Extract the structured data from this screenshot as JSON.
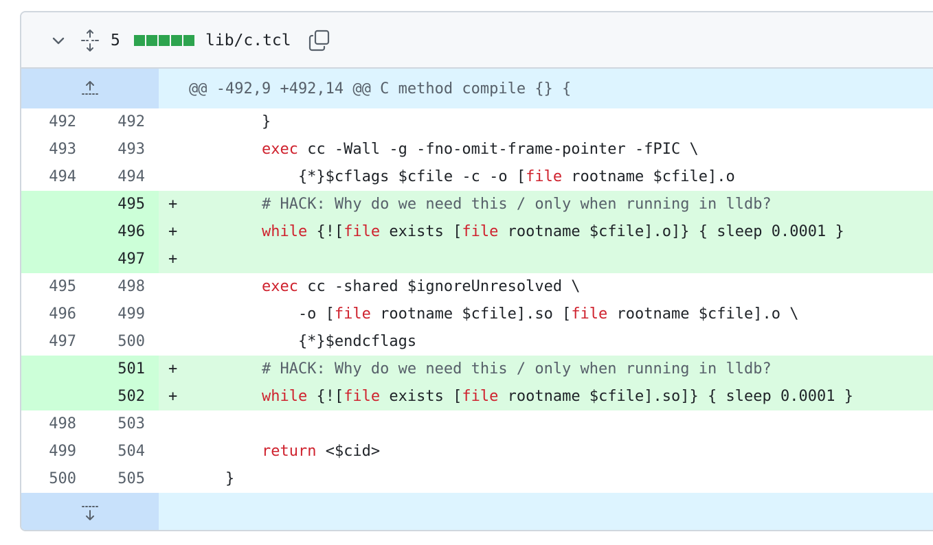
{
  "file_header": {
    "changes_count": "5",
    "diffstat_colors": [
      "#2da44e",
      "#2da44e",
      "#2da44e",
      "#2da44e",
      "#2da44e"
    ],
    "file_name": "lib/c.tcl",
    "icons": {
      "collapse": "chevron-down-icon",
      "expand": "unfold-icon",
      "copy": "copy-icon"
    }
  },
  "hunk": {
    "header": "@@ -492,9 +492,14 @@ C method compile {} {",
    "expand_up_icon": "expand-up-icon",
    "expand_down_icon": "expand-down-icon"
  },
  "lines": [
    {
      "type": "ctx",
      "old": "492",
      "new": "492",
      "segs": [
        {
          "t": "        }"
        }
      ]
    },
    {
      "type": "ctx",
      "old": "493",
      "new": "493",
      "segs": [
        {
          "t": "        "
        },
        {
          "t": "exec",
          "c": "kw"
        },
        {
          "t": " cc -Wall -g -fno-omit-frame-pointer -fPIC \\"
        }
      ]
    },
    {
      "type": "ctx",
      "old": "494",
      "new": "494",
      "segs": [
        {
          "t": "            {*}$cflags $cfile -c -o ["
        },
        {
          "t": "file",
          "c": "kw"
        },
        {
          "t": " rootname $cfile].o"
        }
      ]
    },
    {
      "type": "add",
      "old": "",
      "new": "495",
      "segs": [
        {
          "t": "        "
        },
        {
          "t": "# HACK: Why do we need this / only when running in lldb?",
          "c": "cm"
        }
      ]
    },
    {
      "type": "add",
      "old": "",
      "new": "496",
      "segs": [
        {
          "t": "        "
        },
        {
          "t": "while",
          "c": "kw"
        },
        {
          "t": " {!["
        },
        {
          "t": "file",
          "c": "kw"
        },
        {
          "t": " exists ["
        },
        {
          "t": "file",
          "c": "kw"
        },
        {
          "t": " rootname $cfile].o]} { sleep 0.0001 }"
        }
      ]
    },
    {
      "type": "add",
      "old": "",
      "new": "497",
      "segs": [
        {
          "t": ""
        }
      ]
    },
    {
      "type": "ctx",
      "old": "495",
      "new": "498",
      "segs": [
        {
          "t": "        "
        },
        {
          "t": "exec",
          "c": "kw"
        },
        {
          "t": " cc -shared $ignoreUnresolved \\"
        }
      ]
    },
    {
      "type": "ctx",
      "old": "496",
      "new": "499",
      "segs": [
        {
          "t": "            -o ["
        },
        {
          "t": "file",
          "c": "kw"
        },
        {
          "t": " rootname $cfile].so ["
        },
        {
          "t": "file",
          "c": "kw"
        },
        {
          "t": " rootname $cfile].o \\"
        }
      ]
    },
    {
      "type": "ctx",
      "old": "497",
      "new": "500",
      "segs": [
        {
          "t": "            {*}$endcflags"
        }
      ]
    },
    {
      "type": "add",
      "old": "",
      "new": "501",
      "segs": [
        {
          "t": "        "
        },
        {
          "t": "# HACK: Why do we need this / only when running in lldb?",
          "c": "cm"
        }
      ]
    },
    {
      "type": "add",
      "old": "",
      "new": "502",
      "segs": [
        {
          "t": "        "
        },
        {
          "t": "while",
          "c": "kw"
        },
        {
          "t": " {!["
        },
        {
          "t": "file",
          "c": "kw"
        },
        {
          "t": " exists ["
        },
        {
          "t": "file",
          "c": "kw"
        },
        {
          "t": " rootname $cfile].so]} { sleep 0.0001 }"
        }
      ]
    },
    {
      "type": "ctx",
      "old": "498",
      "new": "503",
      "segs": [
        {
          "t": ""
        }
      ]
    },
    {
      "type": "ctx",
      "old": "499",
      "new": "504",
      "segs": [
        {
          "t": "        "
        },
        {
          "t": "return",
          "c": "kw"
        },
        {
          "t": " <$cid>"
        }
      ]
    },
    {
      "type": "ctx",
      "old": "500",
      "new": "505",
      "segs": [
        {
          "t": "    }"
        }
      ]
    }
  ],
  "colors": {
    "keyword": "#cf222e",
    "comment": "#57606a",
    "added_bg": "#dafbe1",
    "added_gutter_bg": "#ccffd8",
    "hunk_bg": "#ddf4ff",
    "hunk_gutter_bg": "#c8e1fb"
  }
}
